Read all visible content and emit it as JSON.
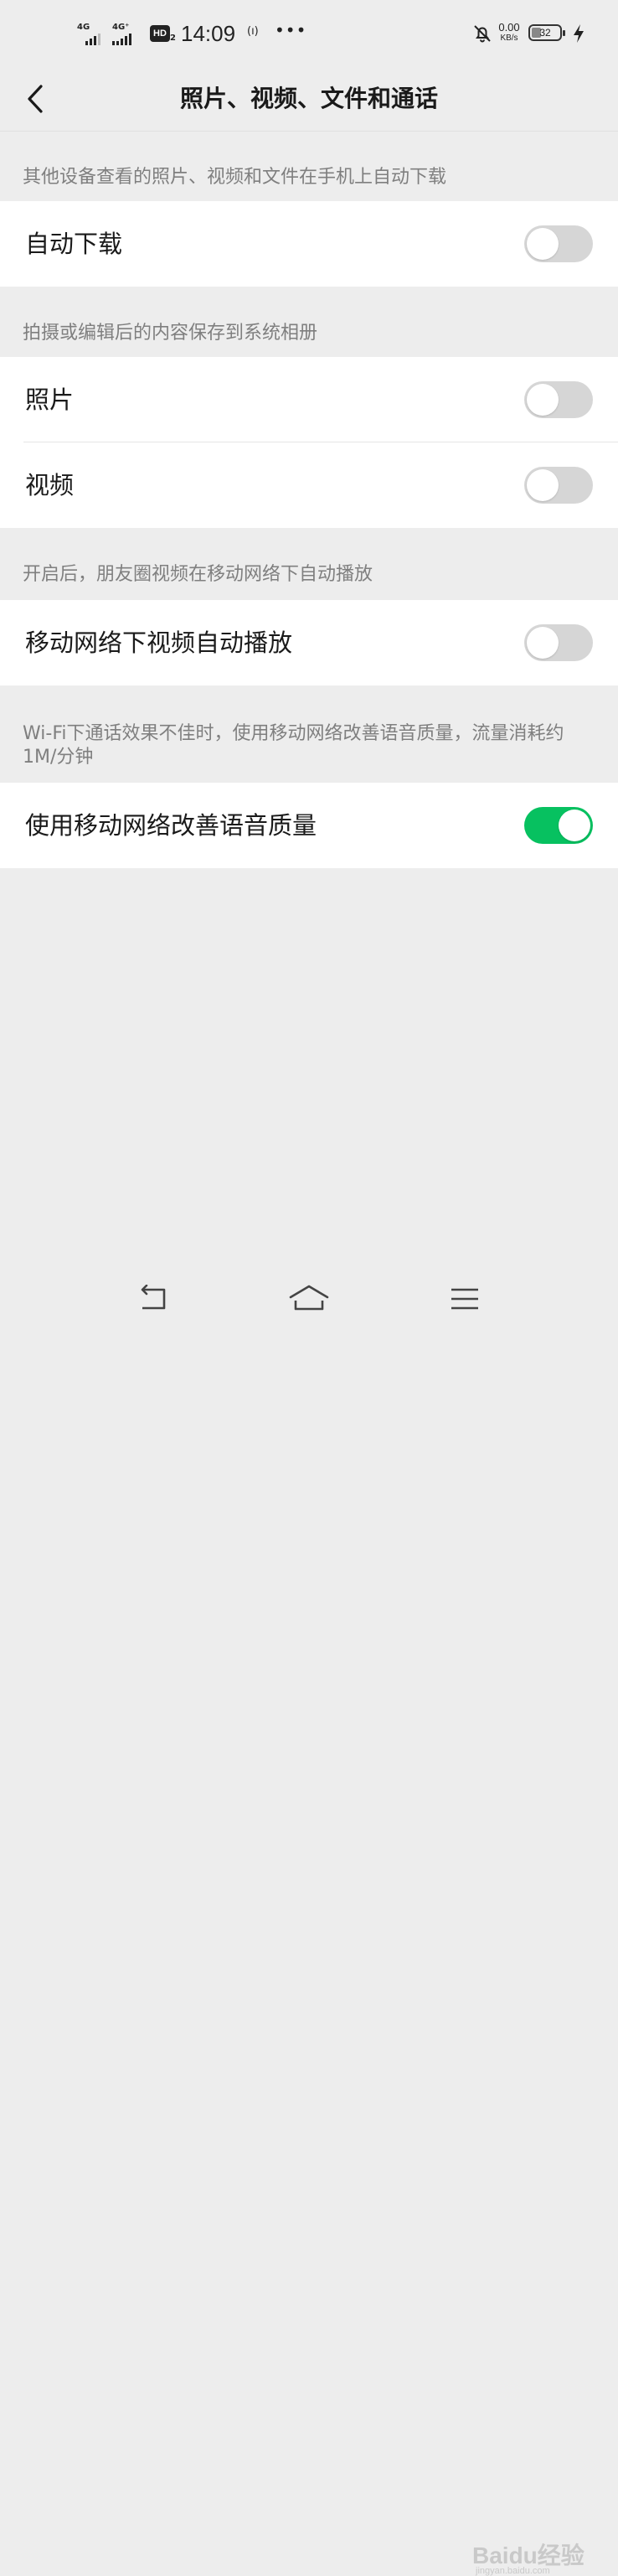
{
  "status_bar": {
    "sim1_label": "4G",
    "sim2_label": "4G⁺",
    "hd_label": "HD",
    "hd_sub": "2",
    "time": "14:09",
    "hotspot_glyph": "(ı)",
    "more_glyph": "•••",
    "net_speed_value": "0.00",
    "net_speed_unit": "KB/s",
    "battery_level": "32",
    "icons": [
      "signal-icon",
      "hd-voice-icon",
      "hotspot-icon",
      "more-icon",
      "mute-bell-icon",
      "battery-icon",
      "charging-icon"
    ]
  },
  "header": {
    "title": "照片、视频、文件和通话",
    "back_icon": "chevron-left-icon"
  },
  "sections": [
    {
      "description": "其他设备查看的照片、视频和文件在手机上自动下载",
      "items": [
        {
          "label": "自动下载",
          "enabled": false
        }
      ]
    },
    {
      "description": "拍摄或编辑后的内容保存到系统相册",
      "items": [
        {
          "label": "照片",
          "enabled": false
        },
        {
          "label": "视频",
          "enabled": false
        }
      ]
    },
    {
      "description": "开启后，朋友圈视频在移动网络下自动播放",
      "items": [
        {
          "label": "移动网络下视频自动播放",
          "enabled": false
        }
      ]
    },
    {
      "description": "Wi-Fi下通话效果不佳时，使用移动网络改善语音质量，流量消耗约1M/分钟",
      "items": [
        {
          "label": "使用移动网络改善语音质量",
          "enabled": true
        }
      ]
    }
  ],
  "system_nav": {
    "icons": [
      "back-nav-icon",
      "home-icon",
      "menu-icon"
    ]
  },
  "watermark": {
    "text": "Baidu经验",
    "sub": "jingyan.baidu.com"
  },
  "colors": {
    "background": "#ededed",
    "toggle_on": "#07c160",
    "toggle_off": "#d6d6d6"
  }
}
